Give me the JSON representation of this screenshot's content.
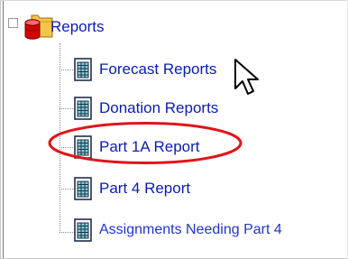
{
  "tree": {
    "root": {
      "label": "Reports",
      "icon": "folder-database-icon"
    },
    "items": [
      {
        "label": "Forecast Reports",
        "icon": "report-icon"
      },
      {
        "label": "Donation Reports",
        "icon": "report-icon"
      },
      {
        "label": "Part 1A Report",
        "icon": "report-icon",
        "highlighted": true
      },
      {
        "label": "Part 4 Report",
        "icon": "report-icon"
      },
      {
        "label": "Assignments Needing Part 4",
        "icon": "report-icon"
      }
    ]
  },
  "colors": {
    "link": "#0b1bb5",
    "highlight": "#e0141c"
  }
}
